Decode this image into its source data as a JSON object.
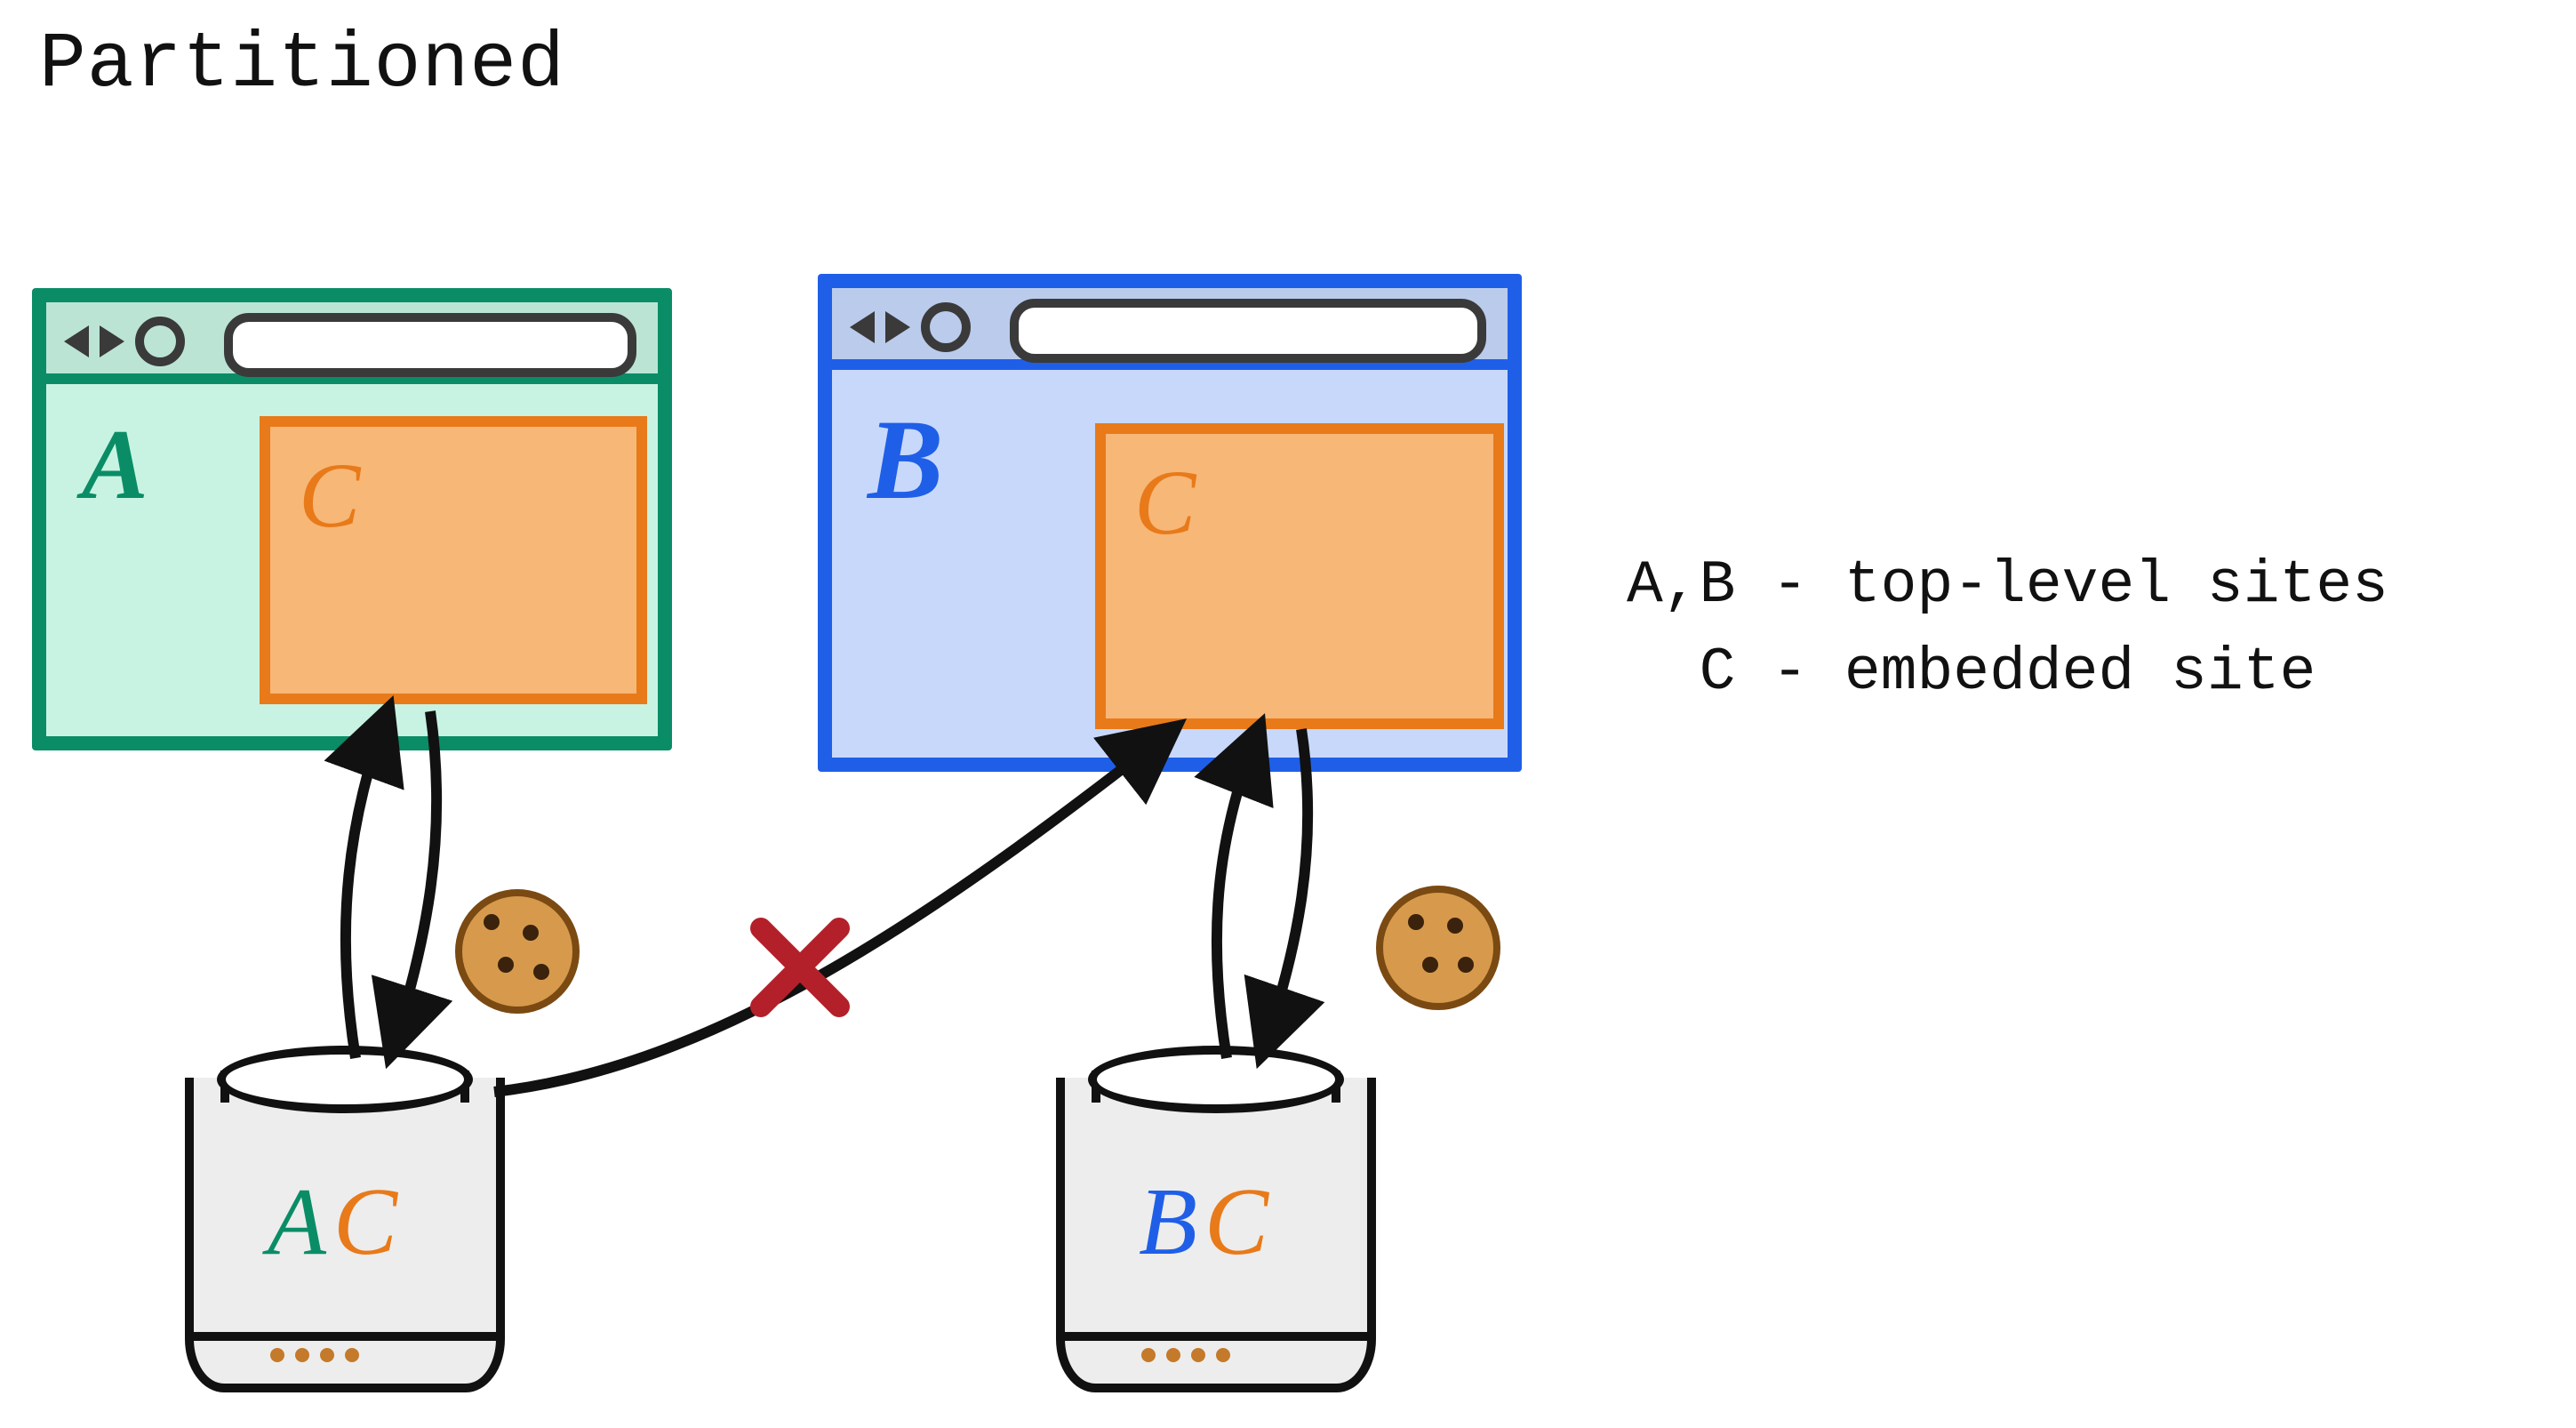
{
  "title": "Partitioned",
  "legend": {
    "line1": "A,B - top-level sites",
    "line2": "  C - embedded site"
  },
  "browsers": {
    "A": {
      "label": "A",
      "embeddedLabel": "C",
      "color": "#0a8d66"
    },
    "B": {
      "label": "B",
      "embeddedLabel": "C",
      "color": "#1f5fe8"
    }
  },
  "jars": {
    "A": {
      "partitionKey": "A",
      "site": "C"
    },
    "B": {
      "partitionKey": "B",
      "site": "C"
    }
  },
  "arrows": {
    "AtoJarA": "bidirectional",
    "BtoJarB": "bidirectional",
    "JarAtoB": "blocked"
  },
  "cookies": [
    "cookie-near-A",
    "cookie-near-B"
  ],
  "blockedMarker": "X"
}
